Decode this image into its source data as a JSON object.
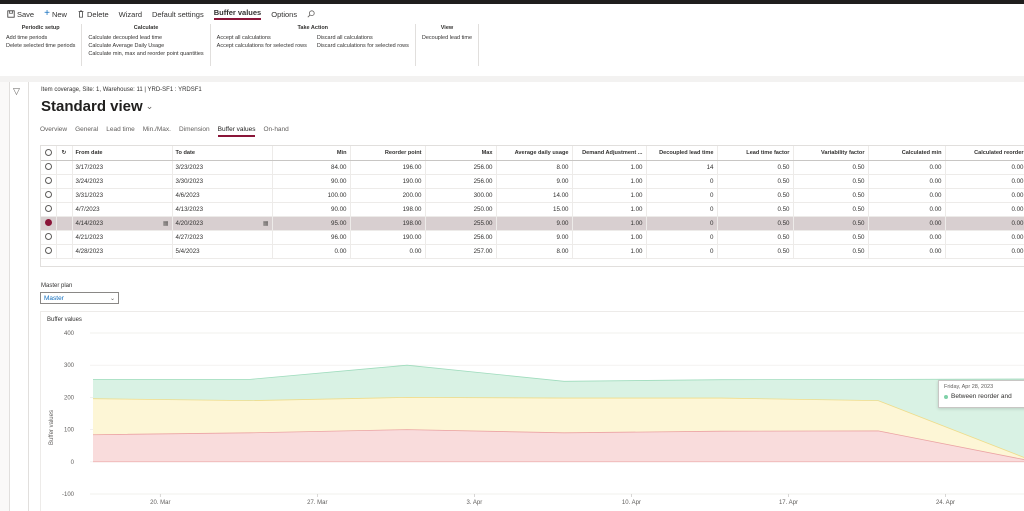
{
  "colors": {
    "accent": "#8a1538",
    "zone_green": "#d9f2e4",
    "zone_yellow": "#fdf6d6",
    "zone_red": "#f9dcdc",
    "link_blue": "#0f6cbd"
  },
  "commands": [
    {
      "label": "Save",
      "icon": "save-icon"
    },
    {
      "label": "New",
      "icon": "plus-icon"
    },
    {
      "label": "Delete",
      "icon": "delete-icon"
    },
    {
      "label": "Wizard"
    },
    {
      "label": "Default settings"
    },
    {
      "label": "Buffer values",
      "active": true
    },
    {
      "label": "Options"
    }
  ],
  "ribbon": {
    "periodic": {
      "title": "Periodic setup",
      "items": [
        "Add time periods",
        "Delete selected time periods"
      ]
    },
    "calculate": {
      "title": "Calculate",
      "items": [
        "Calculate decoupled lead time",
        "Calculate Average Daily Usage",
        "Calculate min, max and reorder point quantities"
      ]
    },
    "take_action": {
      "title": "Take Action",
      "col1": [
        "Accept all calculations",
        "Accept calculations for selected rows"
      ],
      "col2": [
        "Discard all calculations",
        "Discard calculations for selected rows"
      ]
    },
    "view": {
      "title": "View",
      "items": [
        "Decoupled lead time"
      ]
    }
  },
  "breadcrumb": "Item coverage, Site: 1, Warehouse: 11  |  YRD-SF1 : YRDSF1",
  "view_title": "Standard view",
  "tabs": [
    "Overview",
    "General",
    "Lead time",
    "Min./Max.",
    "Dimension",
    "Buffer values",
    "On-hand"
  ],
  "active_tab": "Buffer values",
  "grid": {
    "headers": [
      "From date",
      "To date",
      "Min",
      "Reorder point",
      "Max",
      "Average daily usage",
      "Demand Adjustment ...",
      "Decoupled lead time",
      "Lead time factor",
      "Variability factor",
      "Calculated min",
      "Calculated reorder"
    ],
    "rows": [
      [
        "3/17/2023",
        "3/23/2023",
        "84.00",
        "196.00",
        "256.00",
        "8.00",
        "1.00",
        "14",
        "0.50",
        "0.50",
        "0.00",
        "0.00"
      ],
      [
        "3/24/2023",
        "3/30/2023",
        "90.00",
        "190.00",
        "256.00",
        "9.00",
        "1.00",
        "0",
        "0.50",
        "0.50",
        "0.00",
        "0.00"
      ],
      [
        "3/31/2023",
        "4/6/2023",
        "100.00",
        "200.00",
        "300.00",
        "14.00",
        "1.00",
        "0",
        "0.50",
        "0.50",
        "0.00",
        "0.00"
      ],
      [
        "4/7/2023",
        "4/13/2023",
        "90.00",
        "198.00",
        "250.00",
        "15.00",
        "1.00",
        "0",
        "0.50",
        "0.50",
        "0.00",
        "0.00"
      ],
      [
        "4/14/2023",
        "4/20/2023",
        "95.00",
        "198.00",
        "255.00",
        "9.00",
        "1.00",
        "0",
        "0.50",
        "0.50",
        "0.00",
        "0.00"
      ],
      [
        "4/21/2023",
        "4/27/2023",
        "96.00",
        "190.00",
        "256.00",
        "9.00",
        "1.00",
        "0",
        "0.50",
        "0.50",
        "0.00",
        "0.00"
      ],
      [
        "4/28/2023",
        "5/4/2023",
        "0.00",
        "0.00",
        "257.00",
        "8.00",
        "1.00",
        "0",
        "0.50",
        "0.50",
        "0.00",
        "0.00"
      ]
    ],
    "selected_row": 4
  },
  "master_plan": {
    "label": "Master plan",
    "value": "Master"
  },
  "chart_data": {
    "type": "area",
    "title": "Buffer values",
    "ylabel": "Buffer values",
    "ylim": [
      -100,
      400
    ],
    "yticks": [
      -100,
      0,
      100,
      200,
      300,
      400
    ],
    "xticks": [
      "20. Mar",
      "27. Mar",
      "3. Apr",
      "10. Apr",
      "17. Apr",
      "24. Apr"
    ],
    "xtick_days": [
      3,
      10,
      17,
      24,
      31,
      38
    ],
    "x": [
      0,
      7,
      14,
      21,
      28,
      35,
      42
    ],
    "x_dates": [
      "3/17/2023",
      "3/24/2023",
      "3/31/2023",
      "4/7/2023",
      "4/14/2023",
      "4/21/2023",
      "4/28/2023"
    ],
    "series": [
      {
        "values": [
          256,
          256,
          300,
          250,
          255,
          256,
          257
        ]
      },
      {
        "values": [
          196,
          190,
          200,
          198,
          198,
          190,
          0
        ]
      },
      {
        "values": [
          84,
          90,
          100,
          90,
          95,
          96,
          0
        ]
      }
    ],
    "tooltip": {
      "date": "Friday, Apr 28, 2023",
      "text": "Between reorder and"
    }
  }
}
